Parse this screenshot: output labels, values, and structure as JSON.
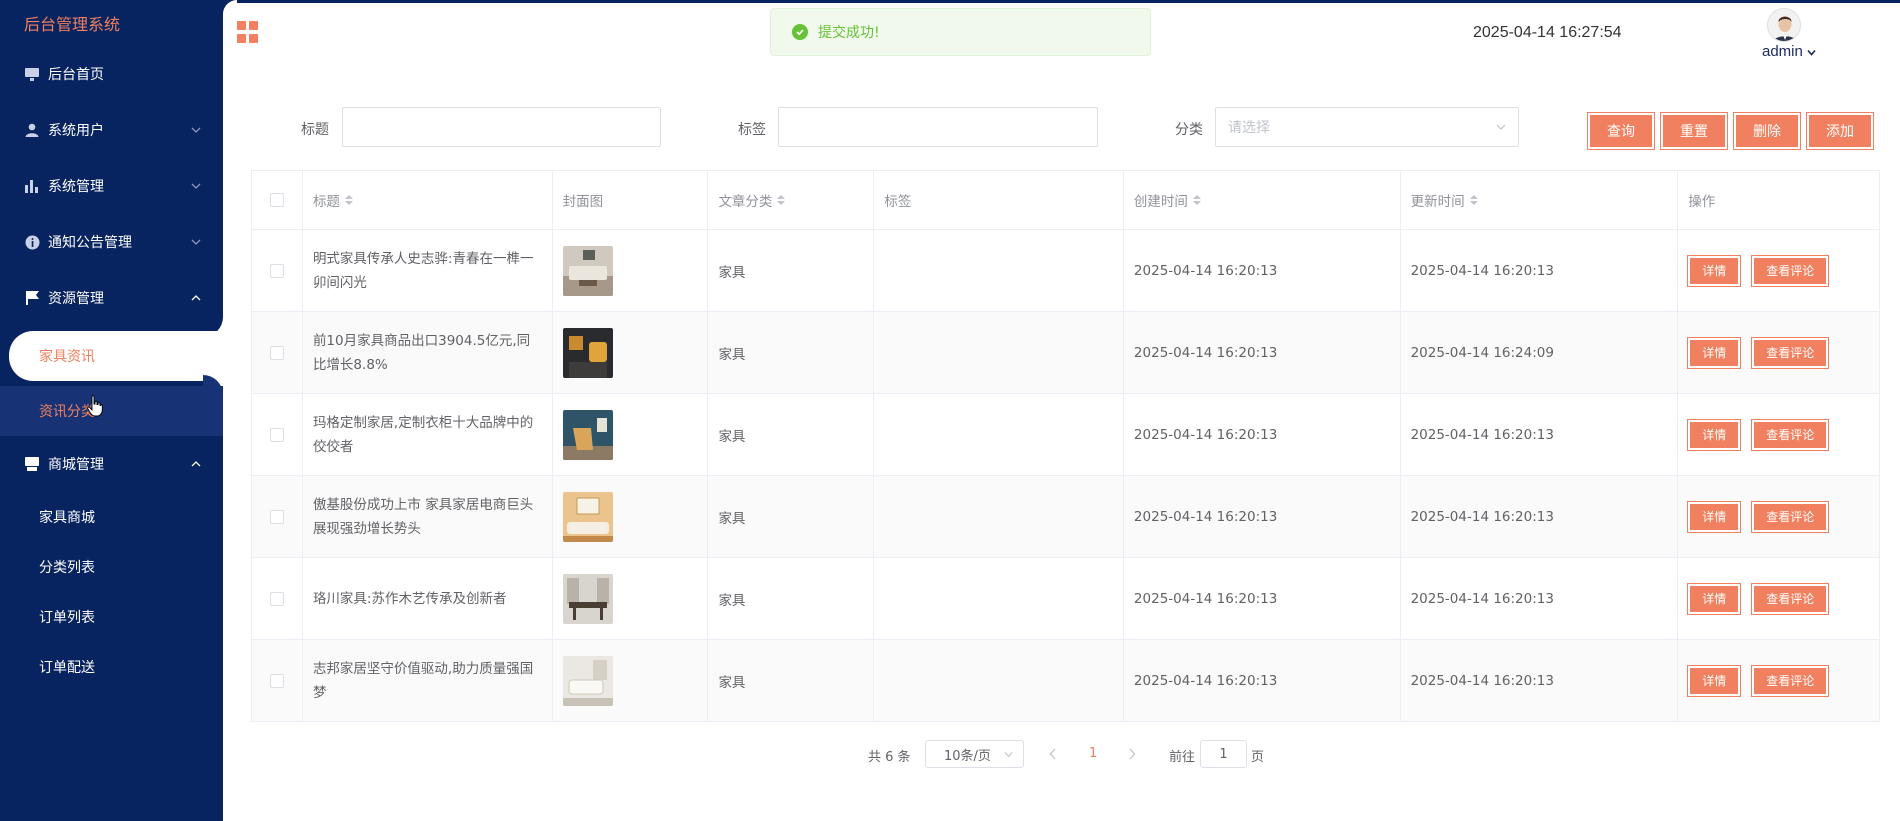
{
  "app": {
    "brand": "后台管理系统"
  },
  "sidebar": {
    "items": [
      {
        "label": "后台首页",
        "icon": "monitor-icon"
      },
      {
        "label": "系统用户",
        "icon": "user-icon"
      },
      {
        "label": "系统管理",
        "icon": "bar-chart-icon"
      },
      {
        "label": "通知公告管理",
        "icon": "info-icon"
      },
      {
        "label": "资源管理",
        "icon": "flag-icon"
      },
      {
        "label": "商城管理",
        "icon": "store-icon"
      }
    ],
    "resource_sub": [
      "家具资讯",
      "资讯分类"
    ],
    "mall_sub": [
      "家具商城",
      "分类列表",
      "订单列表",
      "订单配送"
    ]
  },
  "header": {
    "toast": "提交成功!",
    "datetime": "2025-04-14 16:27:54",
    "user": "admin"
  },
  "search": {
    "title_label": "标题",
    "tag_label": "标签",
    "category_label": "分类",
    "category_placeholder": "请选择",
    "buttons": {
      "query": "查询",
      "reset": "重置",
      "delete": "删除",
      "add": "添加"
    }
  },
  "table": {
    "headers": [
      "标题",
      "封面图",
      "文章分类",
      "标签",
      "创建时间",
      "更新时间",
      "操作"
    ],
    "rows": [
      {
        "title": "明式家具传承人史志骅:青春在一榫一卯间闪光",
        "category": "家具",
        "tag": "",
        "created": "2025-04-14 16:20:13",
        "updated": "2025-04-14 16:20:13"
      },
      {
        "title": "前10月家具商品出口3904.5亿元,同比增长8.8%",
        "category": "家具",
        "tag": "",
        "created": "2025-04-14 16:20:13",
        "updated": "2025-04-14 16:24:09"
      },
      {
        "title": "玛格定制家居,定制衣柜十大品牌中的佼佼者",
        "category": "家具",
        "tag": "",
        "created": "2025-04-14 16:20:13",
        "updated": "2025-04-14 16:20:13"
      },
      {
        "title": "傲基股份成功上市 家具家居电商巨头展现强劲增长势头",
        "category": "家具",
        "tag": "",
        "created": "2025-04-14 16:20:13",
        "updated": "2025-04-14 16:20:13"
      },
      {
        "title": "珞川家具:苏作木艺传承及创新者",
        "category": "家具",
        "tag": "",
        "created": "2025-04-14 16:20:13",
        "updated": "2025-04-14 16:20:13"
      },
      {
        "title": "志邦家居坚守价值驱动,助力质量强国梦",
        "category": "家具",
        "tag": "",
        "created": "2025-04-14 16:20:13",
        "updated": "2025-04-14 16:20:13"
      }
    ],
    "detail_label": "详情",
    "comment_label": "查看评论"
  },
  "pagination": {
    "total": "共 6 条",
    "page_size": "10条/页",
    "current": "1",
    "goto_prefix": "前往",
    "goto_value": "1",
    "goto_suffix": "页"
  },
  "colors": {
    "sidebar": "#072360",
    "accent": "#f0805f",
    "success": "#67c23a"
  }
}
